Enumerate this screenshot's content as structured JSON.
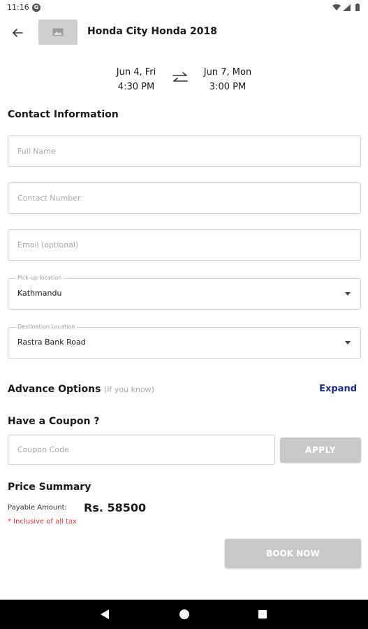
{
  "status_bar": {
    "time": "11:16",
    "g_badge": "G"
  },
  "header": {
    "title": "Honda City Honda 2018"
  },
  "dates": {
    "start": {
      "day": "Jun 4, Fri",
      "time": "4:30 PM"
    },
    "end": {
      "day": "Jun 7, Mon",
      "time": "3:00 PM"
    }
  },
  "contact": {
    "title": "Contact Information",
    "full_name_placeholder": "Full Name",
    "contact_number_placeholder": "Contact Number",
    "email_placeholder": "Email (optional)",
    "pickup": {
      "label": "Pick-up location",
      "value": "Kathmandu"
    },
    "destination": {
      "label": "Destination Location",
      "value": "Rastra Bank Road"
    }
  },
  "advance": {
    "title": "Advance Options",
    "hint": "(If you know)",
    "expand_label": "Expand"
  },
  "coupon": {
    "title": "Have a Coupon ?",
    "placeholder": "Coupon Code",
    "apply_label": "APPLY"
  },
  "price": {
    "title": "Price Summary",
    "payable_label": "Payable Amount:",
    "payable_amount": "Rs. 58500",
    "tax_note": "* Inclusive of all tax"
  },
  "book_label": "BOOK NOW",
  "icons": {
    "back": "arrow-back-icon",
    "swap": "swap-arrows-icon",
    "dropdown": "caret-down-icon",
    "image_placeholder": "image-icon"
  },
  "colors": {
    "accent_link": "#1a2f8a",
    "disabled_button": "#c8c8c8",
    "tax_note": "#e53935"
  }
}
